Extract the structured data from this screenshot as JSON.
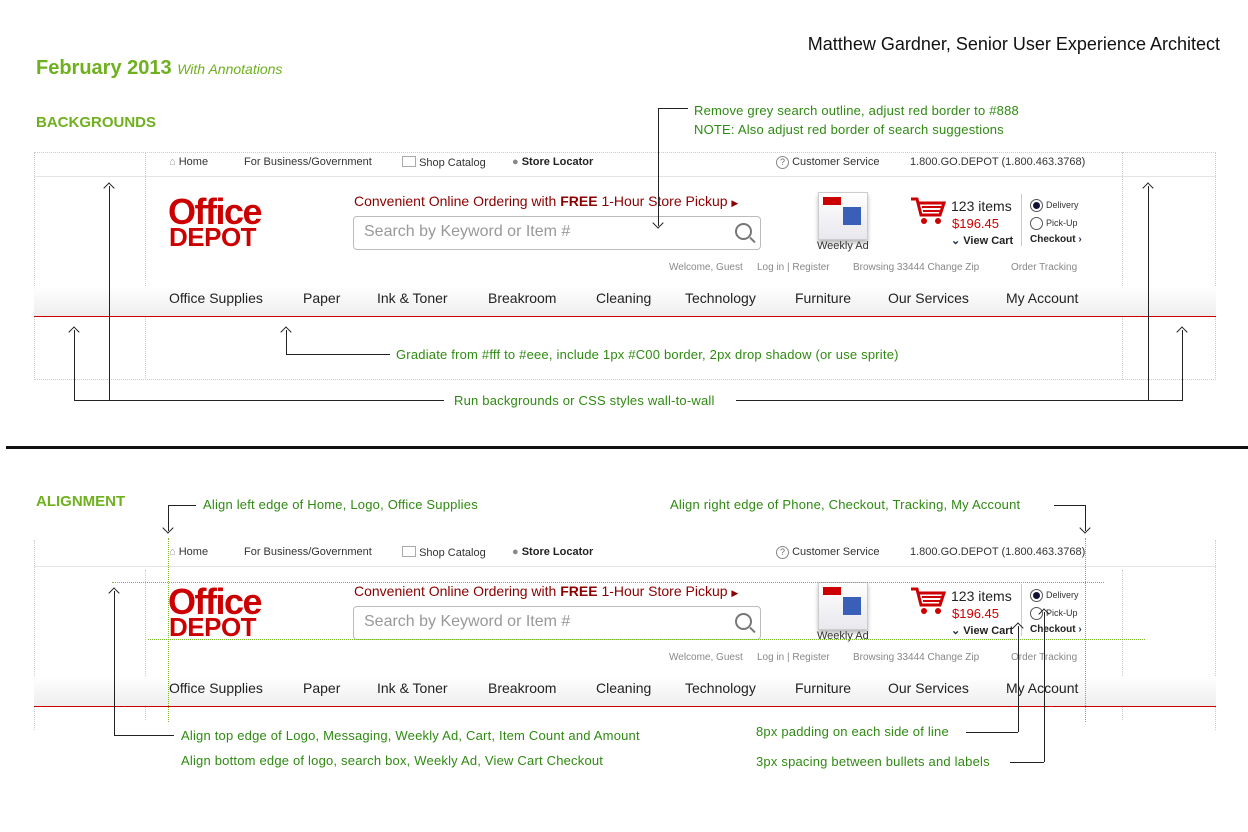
{
  "header": {
    "author": "Matthew Gardner, Senior User Experience Architect",
    "date": "February 2013",
    "subtitle": "With Annotations"
  },
  "sections": {
    "backgrounds": "BACKGROUNDS",
    "alignment": "ALIGNMENT"
  },
  "site": {
    "topbar": {
      "home": "Home",
      "business": "For Business/Government",
      "catalog": "Shop Catalog",
      "store_locator": "Store Locator",
      "customer_service": "Customer Service",
      "phone": "1.800.GO.DEPOT (1.800.463.3768)"
    },
    "logo": {
      "line1": "Office",
      "line2": "DEPOT"
    },
    "promo": {
      "pre": "Convenient Online Ordering with ",
      "bold": "FREE",
      "post": " 1-Hour Store Pickup"
    },
    "search_placeholder": "Search by Keyword or Item #",
    "weekly_ad": "Weekly Ad",
    "cart": {
      "items": "123 items",
      "amount": "$196.45",
      "view_cart": "View Cart",
      "checkout": "Checkout"
    },
    "fulfillment": {
      "delivery": "Delivery",
      "pickup": "Pick-Up"
    },
    "subbar": {
      "welcome": "Welcome, Guest",
      "login": "Log in | Register",
      "browsing": "Browsing 33444 Change Zip",
      "tracking": "Order Tracking"
    },
    "nav": [
      "Office Supplies",
      "Paper",
      "Ink & Toner",
      "Breakroom",
      "Cleaning",
      "Technology",
      "Furniture",
      "Our Services",
      "My Account"
    ]
  },
  "annotations": {
    "search_outline_1": "Remove grey search outline, adjust red border to #888",
    "search_outline_2": "NOTE: Also adjust red border of search suggestions",
    "gradient": "Gradiate from #fff to #eee, include 1px #C00 border,  2px drop shadow (or use sprite)",
    "wall": "Run backgrounds or CSS styles wall-to-wall",
    "align_left": "Align left edge of Home, Logo, Office Supplies",
    "align_right": "Align right edge of Phone, Checkout, Tracking, My Account",
    "align_top": "Align top edge of Logo, Messaging, Weekly Ad, Cart, Item Count and Amount",
    "align_bottom": "Align bottom edge of logo, search box, Weekly Ad, View Cart Checkout",
    "padding": "8px padding on each side of line",
    "spacing": "3px spacing between bullets and labels"
  },
  "colors": {
    "brand_red": "#cc0000",
    "annotation_green": "#2e8b0e",
    "title_green": "#6fb01e"
  }
}
